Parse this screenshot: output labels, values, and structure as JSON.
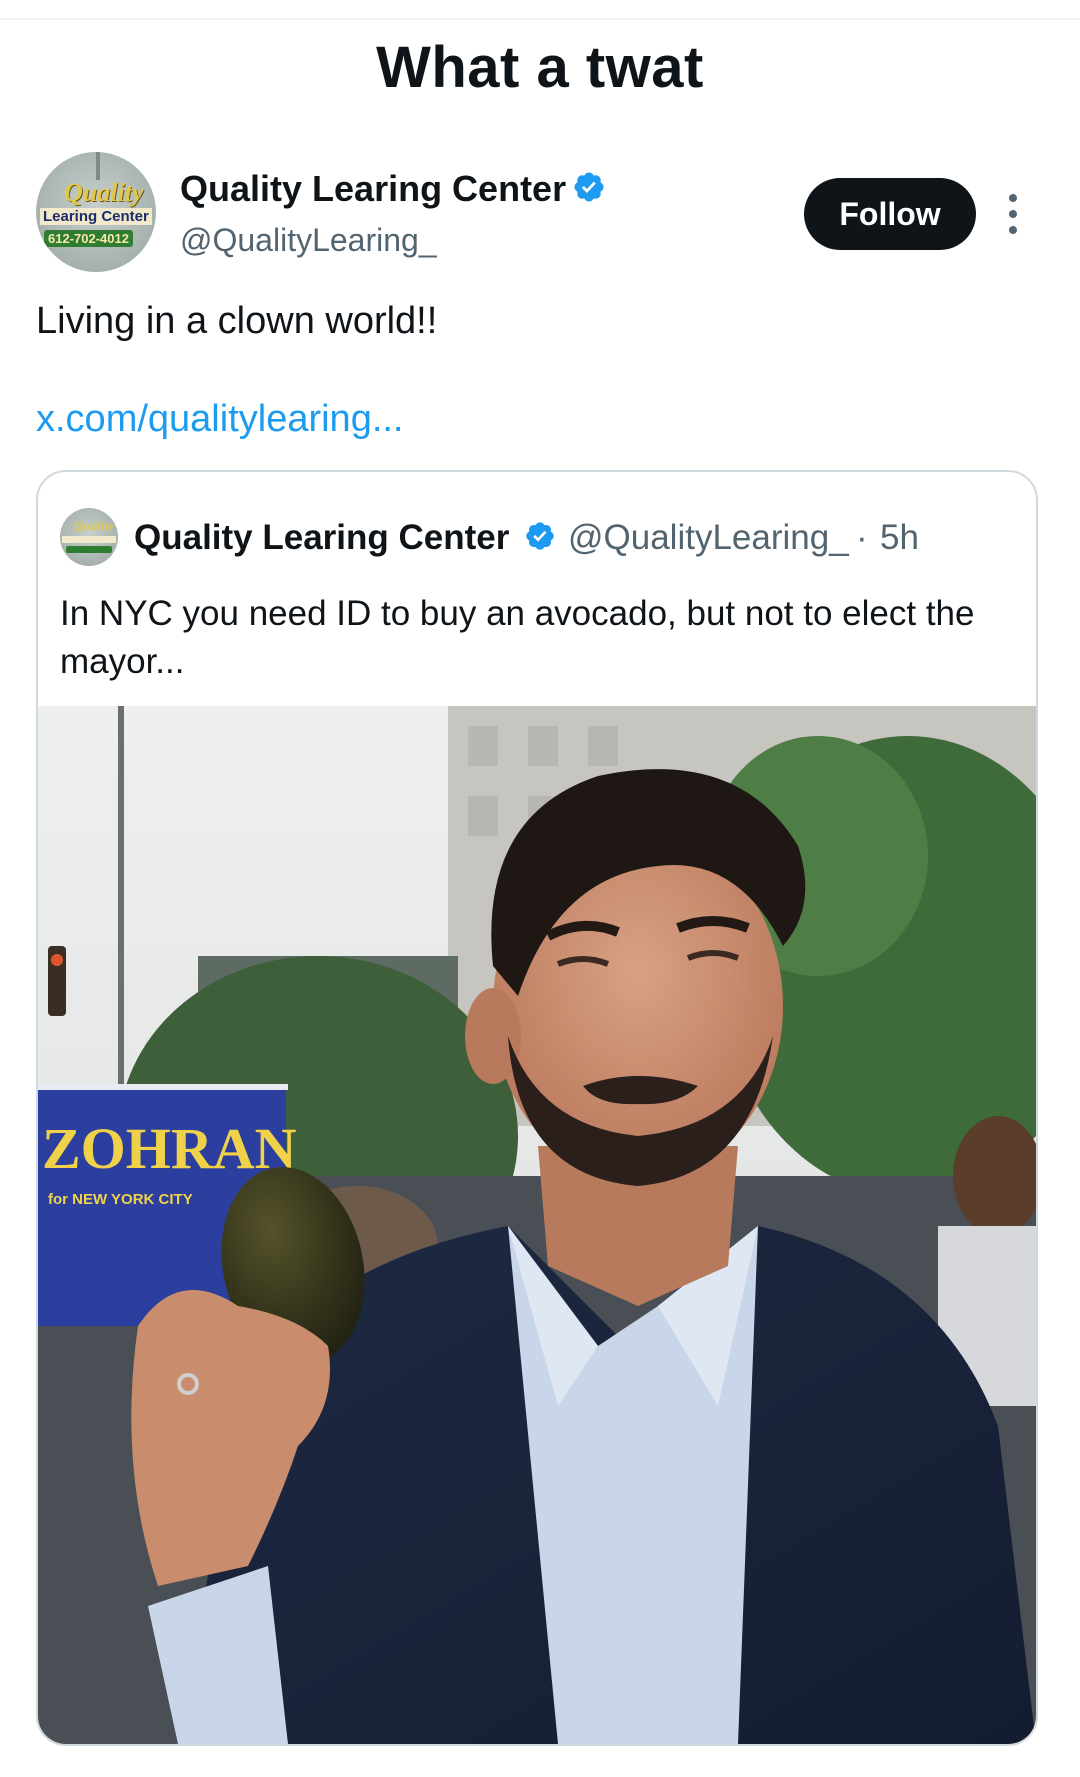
{
  "caption": "What a twat",
  "tweet": {
    "author_name": "Quality Learing Center",
    "handle": "@QualityLearing_",
    "follow_label": "Follow",
    "text": "Living in a clown world!!",
    "link": "x.com/qualitylearing...",
    "avatar_logo": {
      "line1": "Quality",
      "line2": "Learing Center",
      "line3": "612-702-4012"
    }
  },
  "quote": {
    "author_name": "Quality Learing Center",
    "handle": "@QualityLearing_",
    "separator": "·",
    "time": "5h",
    "text": "In NYC you need ID to buy an avocado, but not to elect the mayor...",
    "image_sign": {
      "line1": "ZOHRAN",
      "line2": "for NEW YORK CITY"
    }
  },
  "colors": {
    "verified_badge": "#1d9bf0",
    "link": "#1d9bf0",
    "follow_bg": "#0f1419",
    "secondary_text": "#536471",
    "sign_blue": "#2c3e9e"
  },
  "icons": {
    "verified": "verified-badge-icon",
    "more": "more-vertical-icon"
  }
}
